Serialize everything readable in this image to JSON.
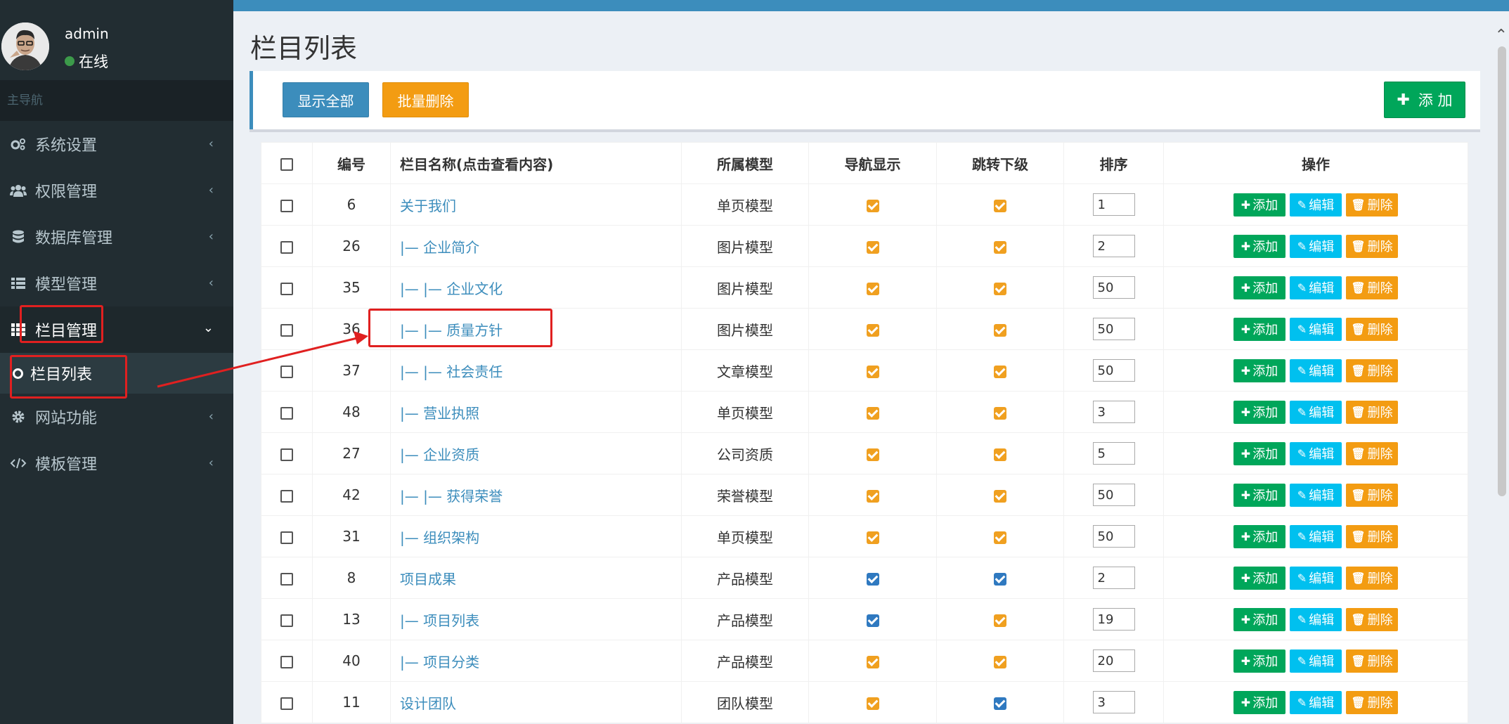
{
  "user": {
    "name": "admin",
    "status": "在线"
  },
  "sidebar": {
    "header": "主导航",
    "items": [
      {
        "label": "系统设置",
        "icon": "gears-icon"
      },
      {
        "label": "权限管理",
        "icon": "users-icon"
      },
      {
        "label": "数据库管理",
        "icon": "database-icon"
      },
      {
        "label": "模型管理",
        "icon": "list-icon"
      },
      {
        "label": "栏目管理",
        "icon": "grid-icon",
        "active": true
      },
      {
        "label": "网站功能",
        "icon": "gear-icon"
      },
      {
        "label": "模板管理",
        "icon": "code-icon"
      }
    ],
    "sub_item": "栏目列表"
  },
  "page": {
    "title": "栏目列表"
  },
  "toolbar": {
    "show_all": "显示全部",
    "batch_delete": "批量删除",
    "add": "添 加"
  },
  "table": {
    "headers": [
      "编号",
      "栏目名称(点击查看内容)",
      "所属模型",
      "导航显示",
      "跳转下级",
      "排序",
      "操作"
    ],
    "row_actions": {
      "add": "添加",
      "edit": "编辑",
      "delete": "删除"
    },
    "rows": [
      {
        "id": "6",
        "name": "关于我们",
        "model": "单页模型",
        "nav": "orange",
        "jump": "orange",
        "sort": "1"
      },
      {
        "id": "26",
        "name": "|— 企业简介",
        "model": "图片模型",
        "nav": "orange",
        "jump": "orange",
        "sort": "2"
      },
      {
        "id": "35",
        "name": "|— |— 企业文化",
        "model": "图片模型",
        "nav": "orange",
        "jump": "orange",
        "sort": "50"
      },
      {
        "id": "36",
        "name": "|— |— 质量方针",
        "model": "图片模型",
        "nav": "orange",
        "jump": "orange",
        "sort": "50"
      },
      {
        "id": "37",
        "name": "|— |— 社会责任",
        "model": "文章模型",
        "nav": "orange",
        "jump": "orange",
        "sort": "50"
      },
      {
        "id": "48",
        "name": "|— 营业执照",
        "model": "单页模型",
        "nav": "orange",
        "jump": "orange",
        "sort": "3"
      },
      {
        "id": "27",
        "name": "|— 企业资质",
        "model": "公司资质",
        "nav": "orange",
        "jump": "orange",
        "sort": "5"
      },
      {
        "id": "42",
        "name": "|— |— 获得荣誉",
        "model": "荣誉模型",
        "nav": "orange",
        "jump": "orange",
        "sort": "50"
      },
      {
        "id": "31",
        "name": "|— 组织架构",
        "model": "单页模型",
        "nav": "orange",
        "jump": "orange",
        "sort": "50"
      },
      {
        "id": "8",
        "name": "项目成果",
        "model": "产品模型",
        "nav": "blue",
        "jump": "blue",
        "sort": "2"
      },
      {
        "id": "13",
        "name": "|— 项目列表",
        "model": "产品模型",
        "nav": "blue",
        "jump": "orange",
        "sort": "19"
      },
      {
        "id": "40",
        "name": "|— 项目分类",
        "model": "产品模型",
        "nav": "orange",
        "jump": "orange",
        "sort": "20"
      },
      {
        "id": "11",
        "name": "设计团队",
        "model": "团队模型",
        "nav": "orange",
        "jump": "blue",
        "sort": "3"
      }
    ]
  },
  "colors": {
    "primary": "#3c8dbc",
    "success": "#00a65a",
    "info": "#00c0ef",
    "warning": "#f39c12",
    "annotation": "#e02020"
  }
}
